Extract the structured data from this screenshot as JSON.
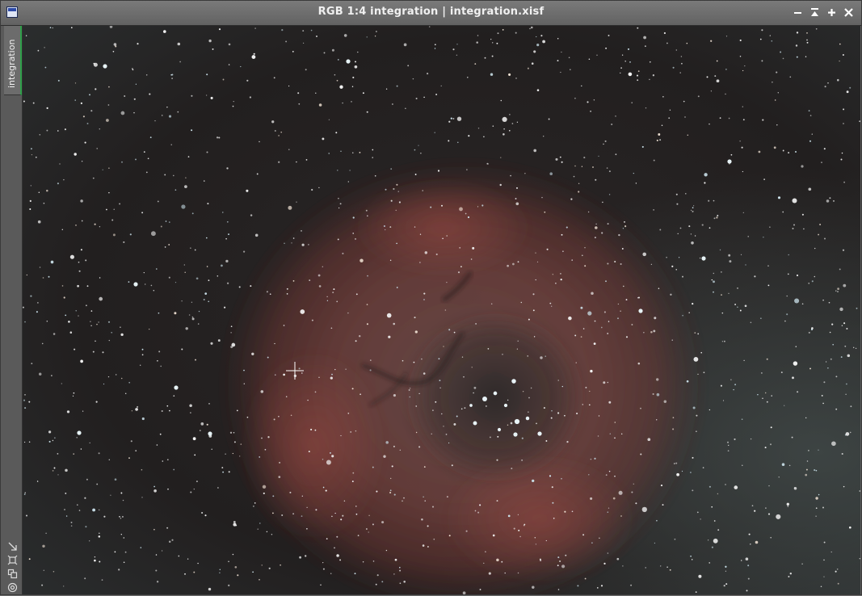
{
  "window": {
    "title": "RGB 1:4 integration | integration.xisf",
    "controls": [
      {
        "name": "minimize-button",
        "glyph": "−"
      },
      {
        "name": "shade-button",
        "glyph": "⏶"
      },
      {
        "name": "maximize-button",
        "glyph": "+"
      },
      {
        "name": "close-button",
        "glyph": "✕"
      }
    ]
  },
  "sidebar": {
    "view_tab_label": "integration",
    "tools": [
      {
        "name": "resize-icon"
      },
      {
        "name": "fit-view-icon"
      },
      {
        "name": "clone-view-icon"
      },
      {
        "name": "target-icon"
      }
    ]
  },
  "image": {
    "subject": "Rosette Nebula astrophotograph",
    "accent_color": "#2fa04a"
  }
}
